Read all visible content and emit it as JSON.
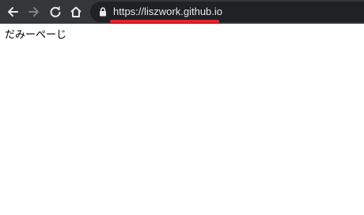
{
  "browser": {
    "url": "https://liszwork.github.io",
    "icons": {
      "back": "back-arrow-icon",
      "forward": "forward-arrow-icon",
      "reload": "reload-icon",
      "home": "home-icon",
      "lock": "lock-icon"
    },
    "colors": {
      "toolbar": "#35363a",
      "omnibox": "#202124",
      "url_text": "#e8eaed",
      "highlight": "#e8202a"
    }
  },
  "page": {
    "text": "だみーぺーじ"
  }
}
